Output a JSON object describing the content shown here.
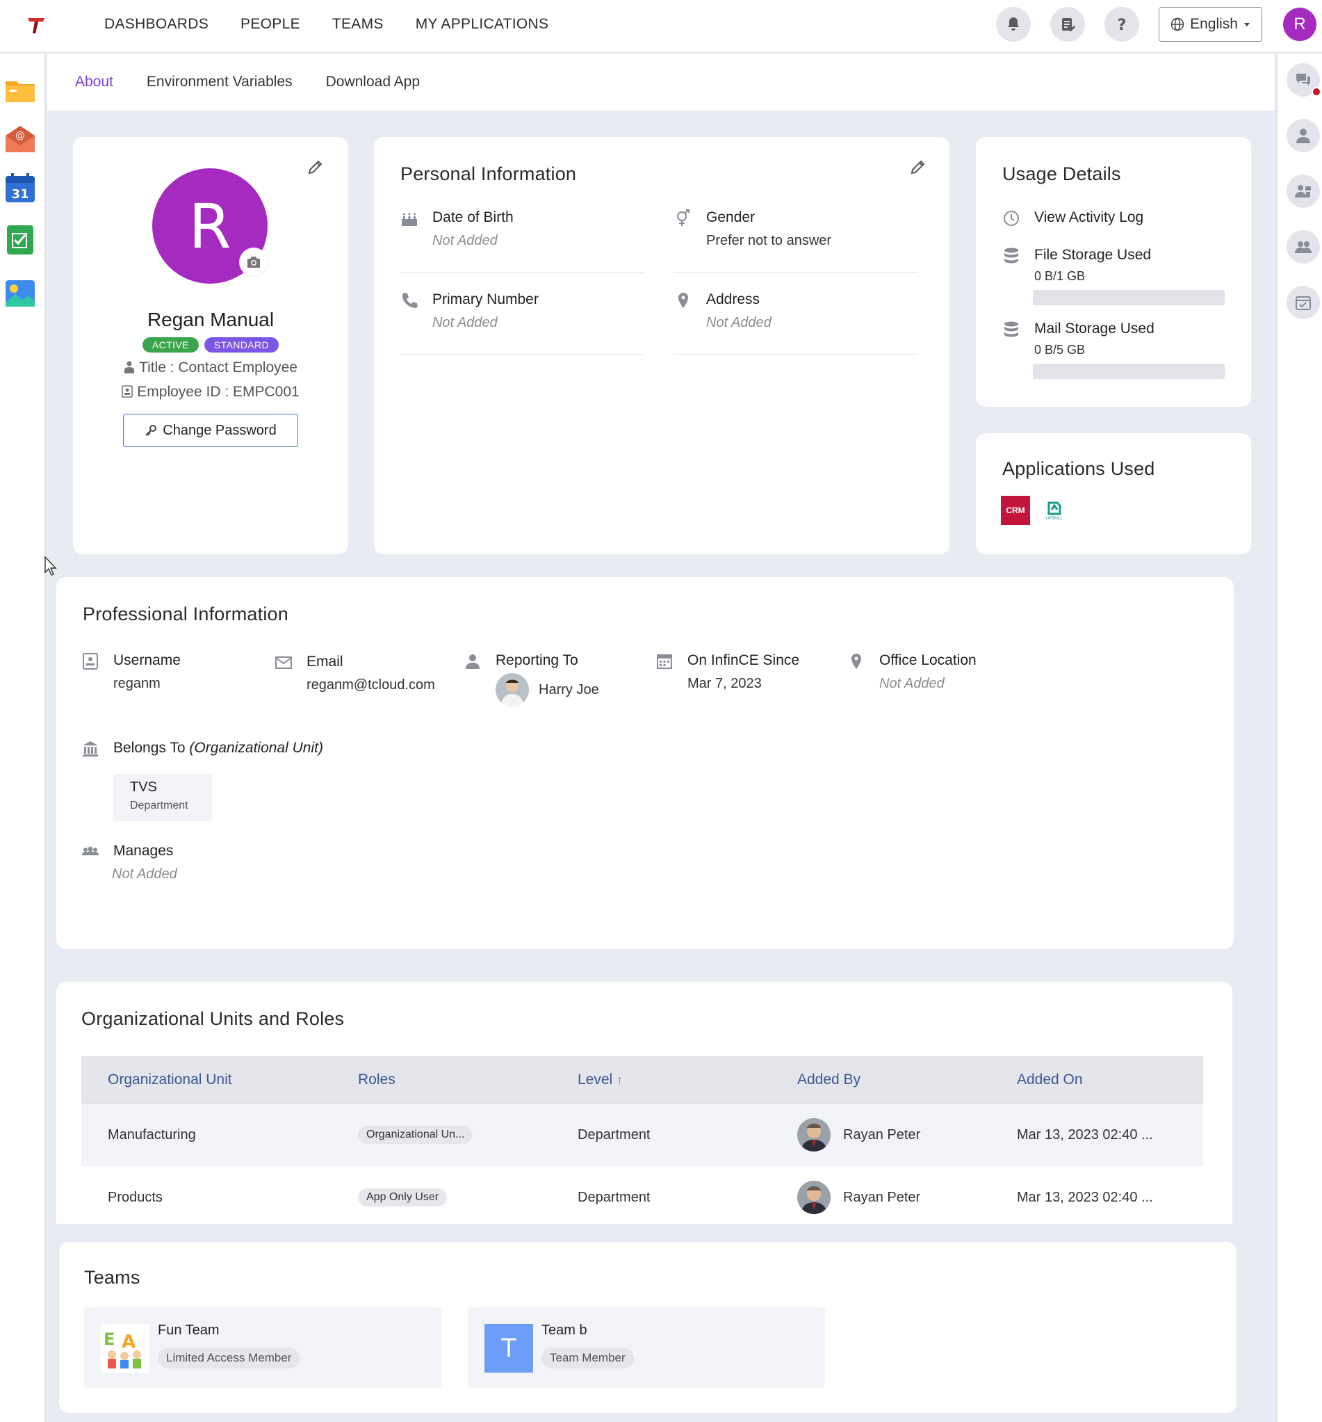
{
  "nav": {
    "items": [
      "DASHBOARDS",
      "PEOPLE",
      "TEAMS",
      "MY APPLICATIONS"
    ]
  },
  "header": {
    "language": "English",
    "avatar_initial": "R"
  },
  "subtabs": [
    "About",
    "Environment Variables",
    "Download App"
  ],
  "profile": {
    "initial": "R",
    "name": "Regan Manual",
    "status_badge": "ACTIVE",
    "tier_badge": "STANDARD",
    "title_line": "Title : Contact Employee",
    "employee_line": "Employee ID : EMPC001",
    "change_password": "Change Password"
  },
  "personal": {
    "title": "Personal Information",
    "dob_label": "Date of Birth",
    "dob_value": "Not Added",
    "gender_label": "Gender",
    "gender_value": "Prefer not to answer",
    "phone_label": "Primary Number",
    "phone_value": "Not Added",
    "address_label": "Address",
    "address_value": "Not Added"
  },
  "usage": {
    "title": "Usage Details",
    "activity": "View Activity Log",
    "file_label": "File Storage Used",
    "file_value": "0 B/1 GB",
    "file_fraction": 0,
    "mail_label": "Mail Storage Used",
    "mail_value": "0 B/5 GB",
    "mail_fraction": 0
  },
  "apps_used": {
    "title": "Applications Used",
    "crm_logo_text": "CRM",
    "app2_logo_text": "UPSKILL"
  },
  "professional": {
    "title": "Professional Information",
    "username_label": "Username",
    "username_value": "reganm",
    "email_label": "Email",
    "email_value": "reganm@tcloud.com",
    "reporting_label": "Reporting To",
    "reporting_value": "Harry Joe",
    "since_label": "On InfinCE Since",
    "since_value": "Mar 7, 2023",
    "office_label": "Office Location",
    "office_value": "Not Added",
    "belongs_label": "Belongs To",
    "belongs_sub": "(Organizational Unit)",
    "ou_name": "TVS",
    "ou_type": "Department",
    "manages_label": "Manages",
    "manages_value": "Not Added"
  },
  "org_roles": {
    "title": "Organizational Units and Roles",
    "headers": [
      "Organizational Unit",
      "Roles",
      "Level",
      "Added By",
      "Added On"
    ],
    "sort_indicator": "↑",
    "rows": [
      {
        "unit": "Manufacturing",
        "role": "Organizational Un...",
        "level": "Department",
        "added_by": "Rayan Peter",
        "added_on": "Mar 13, 2023 02:40 ..."
      },
      {
        "unit": "Products",
        "role": "App Only User",
        "level": "Department",
        "added_by": "Rayan Peter",
        "added_on": "Mar 13, 2023 02:40 ..."
      }
    ]
  },
  "teams": {
    "title": "Teams",
    "items": [
      {
        "name": "Fun Team",
        "role": "Limited Access Member",
        "initial": ""
      },
      {
        "name": "Team b",
        "role": "Team Member",
        "initial": "T"
      }
    ]
  },
  "colors": {
    "accent": "#7a3bd1",
    "avatar": "#a42ac0",
    "active": "#3aa54a",
    "standard": "#7b55e3",
    "table_header": "#3c5596"
  }
}
